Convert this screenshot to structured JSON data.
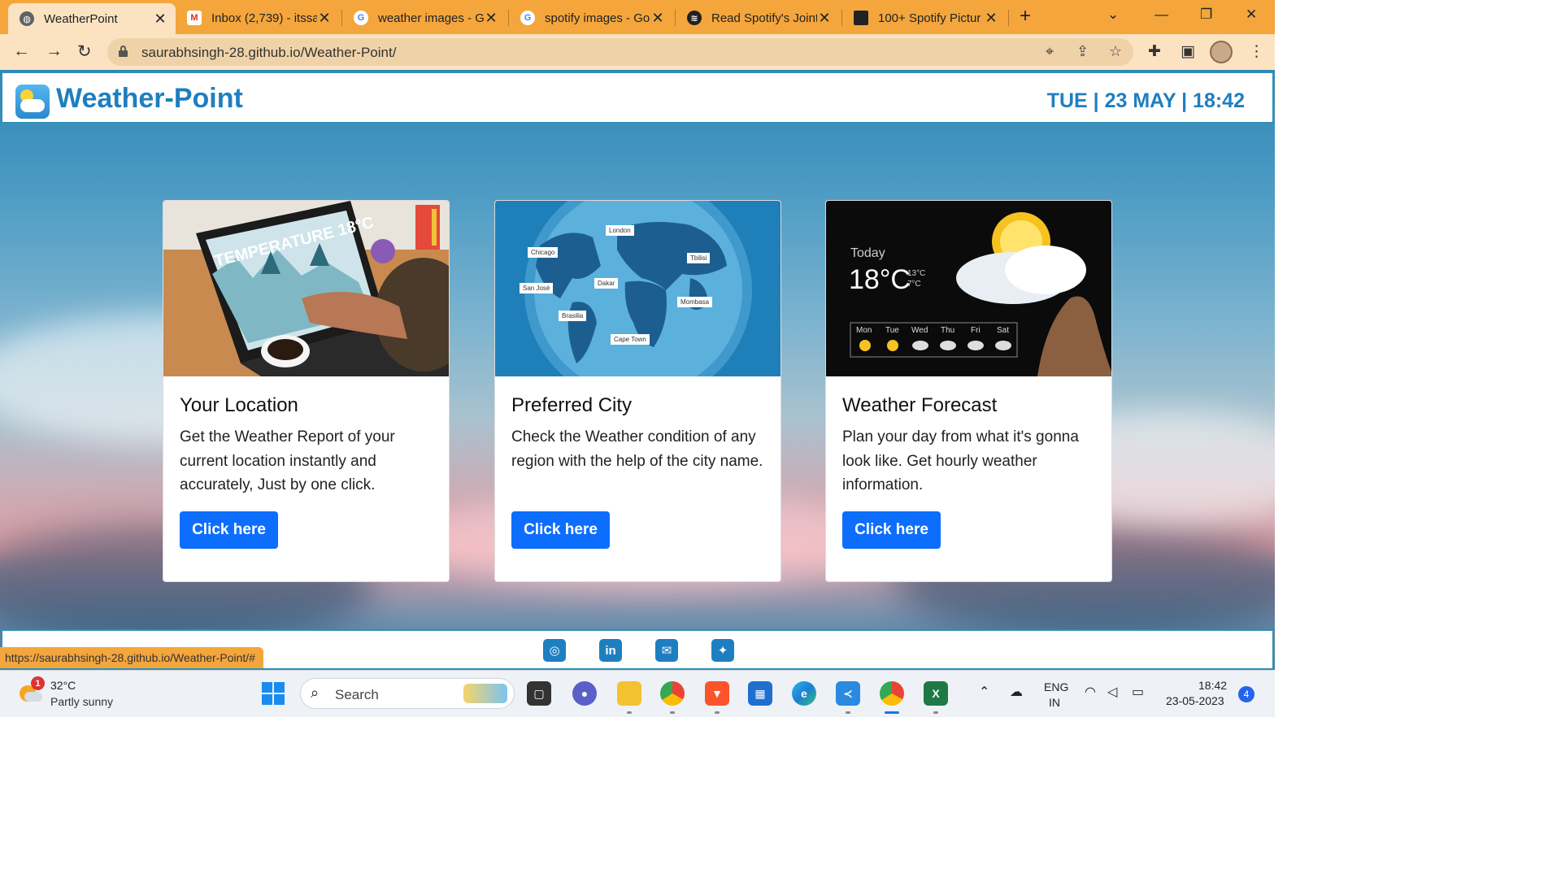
{
  "browser": {
    "tabs": [
      {
        "title": "WeatherPoint",
        "favicon": "globe-icon"
      },
      {
        "title": "Inbox (2,739) - itssa",
        "favicon": "gmail-icon"
      },
      {
        "title": "weather images - G",
        "favicon": "google-icon"
      },
      {
        "title": "spotify images - Go",
        "favicon": "google-icon"
      },
      {
        "title": "Read Spotify's Joint",
        "favicon": "spotify-icon"
      },
      {
        "title": "100+ Spotify Pictur",
        "favicon": "unsplash-icon"
      }
    ],
    "url": "saurabhsingh-28.github.io/Weather-Point/",
    "status_url": "https://saurabhsingh-28.github.io/Weather-Point/#"
  },
  "header": {
    "brand": "Weather-Point",
    "datetime": "TUE | 23 MAY | 18:42"
  },
  "cards": [
    {
      "title": "Your Location",
      "text": "Get the Weather Report of your current location instantly and accurately, Just by one click.",
      "button": "Click here",
      "image_text": "TEMPERATURE 18°C"
    },
    {
      "title": "Preferred City",
      "text": "Check the Weather condition of any region with the help of the city name.",
      "button": "Click here",
      "cities": [
        "London",
        "Chicago",
        "Tbilisi",
        "San José",
        "Dakar",
        "Mombasa",
        "Brasilia",
        "Cape Town"
      ]
    },
    {
      "title": "Weather Forecast",
      "text": "Plan your day from what it's gonna look like. Get hourly weather information.",
      "button": "Click here",
      "today_label": "Today",
      "today_temp": "18°C",
      "hi": "13°C",
      "lo": "7°C",
      "days": [
        "Mon",
        "Tue",
        "Wed",
        "Thu",
        "Fri",
        "Sat"
      ]
    }
  ],
  "footer": {
    "social": [
      "instagram-icon",
      "linkedin-icon",
      "mail-icon",
      "twitter-icon"
    ]
  },
  "taskbar": {
    "weather_temp": "32°C",
    "weather_desc": "Partly sunny",
    "weather_badge": "1",
    "search": "Search",
    "lang1": "ENG",
    "lang2": "IN",
    "time": "18:42",
    "date": "23-05-2023",
    "notifications": "4"
  },
  "colors": {
    "tabbar": "#f4a63c",
    "brand": "#1e7fc0",
    "button": "#0d6efd"
  }
}
